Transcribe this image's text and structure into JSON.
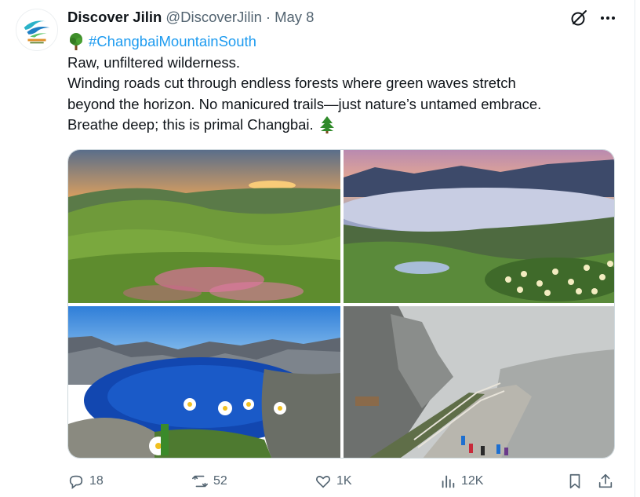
{
  "tweet": {
    "author_name": "Discover Jilin",
    "handle": "@DiscoverJilin",
    "separator": "·",
    "date": "May 8",
    "hashtag": "#ChangbaiMountainSouth",
    "lines": [
      "Raw, unfiltered wilderness.",
      "Winding roads cut through endless forests where green waves stretch",
      "beyond the horizon. No manicured trails—just nature’s untamed embrace.",
      "Breathe deep; this is primal Changbai."
    ],
    "icons": {
      "tree_emoji": "deciduous-tree-emoji",
      "evergreen_emoji": "evergreen-tree-emoji",
      "grok": "grok-icon",
      "more": "more-icon"
    }
  },
  "media": {
    "photos": [
      "photo-sunset-meadow",
      "photo-crater-lake-flowers",
      "photo-blue-heaven-lake",
      "photo-misty-trail"
    ]
  },
  "actions": {
    "replies": "18",
    "reposts": "52",
    "likes": "1K",
    "views": "12K"
  },
  "colors": {
    "text": "#0f1419",
    "secondary": "#536471",
    "link": "#1d9bf0",
    "border": "#cfd9de"
  }
}
